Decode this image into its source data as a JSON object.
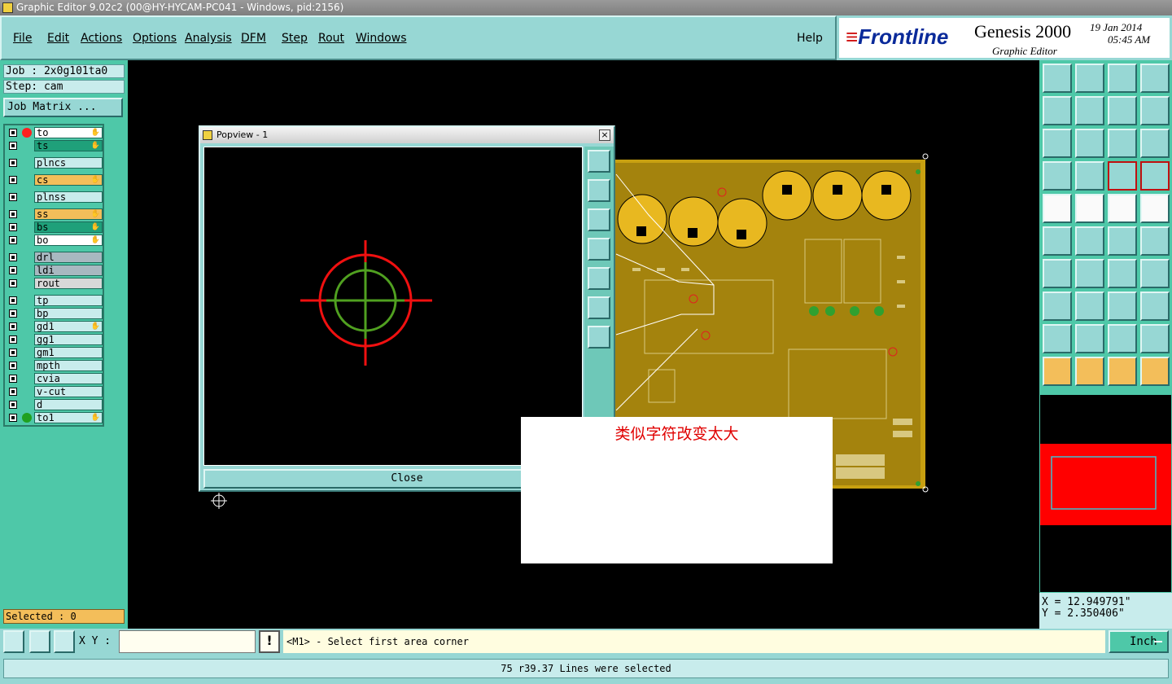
{
  "window": {
    "title": "Graphic Editor 9.02c2 (00@HY-HYCAM-PC041 - Windows, pid:2156)"
  },
  "menu": {
    "items": [
      "File",
      "Edit",
      "Actions",
      "Options",
      "Analysis",
      "DFM",
      "Step",
      "Rout",
      "Windows"
    ],
    "help": "Help"
  },
  "brand": {
    "logo": "Frontline",
    "product": "Genesis 2000",
    "subtitle": "Graphic Editor",
    "date": "19 Jan 2014",
    "time": "05:45 AM"
  },
  "job": {
    "job_label": "Job : 2x0g101ta0",
    "step_label": "Step: cam",
    "matrix_button": "Job Matrix ..."
  },
  "layers": [
    {
      "name": "to",
      "color": "#ffffff",
      "indicator": "#ff2020",
      "hand": true
    },
    {
      "name": "ts",
      "color": "#1fa07a",
      "hand": true
    },
    {
      "name": "plncs",
      "color": "#c8ecec"
    },
    {
      "name": "cs",
      "color": "#f3be5a",
      "hand": true
    },
    {
      "name": "plnss",
      "color": "#c8ecec"
    },
    {
      "name": "ss",
      "color": "#f3be5a",
      "hand": true
    },
    {
      "name": "bs",
      "color": "#1fa07a",
      "hand": true
    },
    {
      "name": "bo",
      "color": "#ffffff",
      "hand": true
    },
    {
      "name": "drl",
      "color": "#a8b8c0"
    },
    {
      "name": "ldi",
      "color": "#a8b8c0"
    },
    {
      "name": "rout",
      "color": "#d8d8d8"
    },
    {
      "name": "tp",
      "color": "#c8ecec"
    },
    {
      "name": "bp",
      "color": "#c8ecec"
    },
    {
      "name": "gd1",
      "color": "#c8ecec",
      "hand": true
    },
    {
      "name": "gg1",
      "color": "#c8ecec"
    },
    {
      "name": "gm1",
      "color": "#c8ecec"
    },
    {
      "name": "mpth",
      "color": "#c8ecec"
    },
    {
      "name": "cvia",
      "color": "#c8ecec"
    },
    {
      "name": "v-cut",
      "color": "#c8ecec"
    },
    {
      "name": "d",
      "color": "#c8ecec"
    },
    {
      "name": "to1",
      "color": "#c8ecec",
      "indicator": "#20a020",
      "hand": true
    }
  ],
  "selected": "Selected : 0",
  "popview": {
    "title": "Popview - 1",
    "close_x": "×",
    "close_button": "Close"
  },
  "annotation": {
    "text": "类似字符改变太大"
  },
  "coords": {
    "x": "X = 12.949791\"",
    "y": "Y = 2.350406\""
  },
  "bottom": {
    "xy_label": "X Y :",
    "xy_value": "",
    "excl": "!",
    "prompt": "<M1> - Select first area corner",
    "unit": "Inch"
  },
  "status": {
    "message": "75 r39.37 Lines were selected"
  }
}
